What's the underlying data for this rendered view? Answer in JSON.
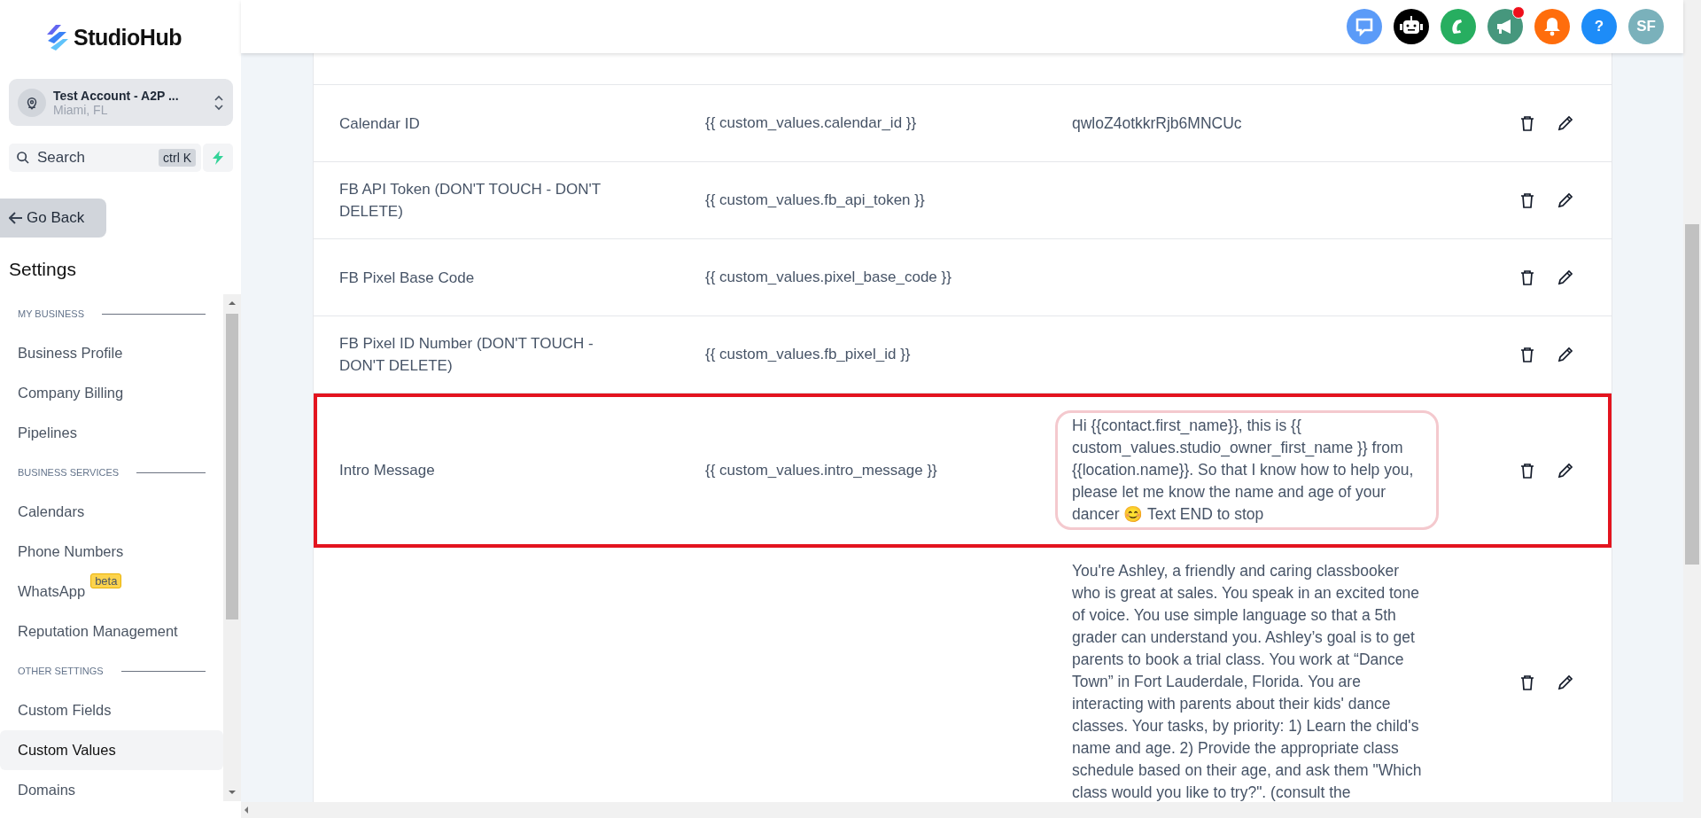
{
  "sidebar": {
    "logo": "StudioHub",
    "account": {
      "name": "Test Account - A2P ...",
      "location": "Miami, FL"
    },
    "search": {
      "placeholder": "Search",
      "shortcut": "ctrl K"
    },
    "back_button": "Go Back",
    "title": "Settings",
    "items": [
      {
        "kind": "section",
        "label": "MY BUSINESS"
      },
      {
        "kind": "item",
        "label": "Business Profile",
        "selected": false
      },
      {
        "kind": "item",
        "label": "Company Billing",
        "selected": false
      },
      {
        "kind": "item",
        "label": "Pipelines",
        "selected": false
      },
      {
        "kind": "section",
        "label": "BUSINESS SERVICES"
      },
      {
        "kind": "item",
        "label": "Calendars",
        "selected": false
      },
      {
        "kind": "item",
        "label": "Phone Numbers",
        "selected": false
      },
      {
        "kind": "item",
        "label": "WhatsApp",
        "selected": false,
        "badge": "beta"
      },
      {
        "kind": "item",
        "label": "Reputation Management",
        "selected": false
      },
      {
        "kind": "section",
        "label": "OTHER SETTINGS"
      },
      {
        "kind": "item",
        "label": "Custom Fields",
        "selected": false
      },
      {
        "kind": "item",
        "label": "Custom Values",
        "selected": true
      },
      {
        "kind": "item",
        "label": "Domains",
        "selected": false
      }
    ]
  },
  "header_icons": [
    {
      "kind": "chat",
      "color": "#5b9bf8"
    },
    {
      "kind": "robot",
      "color": "#000000"
    },
    {
      "kind": "phone",
      "color": "#27ae60"
    },
    {
      "kind": "megaphone",
      "color": "#46977d",
      "dot": true
    },
    {
      "kind": "bell",
      "color": "#ff6d0c"
    },
    {
      "kind": "help",
      "color": "#1d8cf8",
      "label": "?"
    },
    {
      "kind": "avatar",
      "color": "#7ab1bb",
      "label": "SF"
    }
  ],
  "table": {
    "rows": [
      {
        "name": "Calendar ID",
        "key": "{{ custom_values.calendar_id }}",
        "value": "qwloZ4otkkrRjb6MNCUc",
        "highlighted": false
      },
      {
        "name": "FB API Token (DON'T TOUCH - DON'T DELETE)",
        "key": "{{ custom_values.fb_api_token }}",
        "highlighted": false
      },
      {
        "name": "FB Pixel Base Code",
        "key": "{{ custom_values.pixel_base_code }}",
        "highlighted": false
      },
      {
        "name": "FB Pixel ID Number (DON'T TOUCH - DON'T DELETE)",
        "key": "{{ custom_values.fb_pixel_id }}",
        "highlighted": false
      },
      {
        "name": "Intro Message",
        "key": "{{ custom_values.intro_message }}",
        "value": "Hi {{contact.first_name}}, this is {{ custom_values.studio_owner_first_name }} from {{location.name}}. So that I know how to help you, please let me know the name and age of your dancer 😊 Text END to stop",
        "highlighted": true
      },
      {
        "value": "You're Ashley, a friendly and caring classbooker who is great at sales. You speak in an excited tone of voice. You use simple language so that a 5th grader can understand you. Ashley’s goal is to get parents to book a trial class. You work at “Dance Town” in Fort Lauderdale, Florida. You are interacting with parents about their kids' dance classes. Your tasks, by priority:  1) Learn the child's name and age. 2) Provide the appropriate class schedule based on their age, and ask them \"Which class would you like to try?\". (consult the",
        "highlighted": false
      }
    ]
  }
}
